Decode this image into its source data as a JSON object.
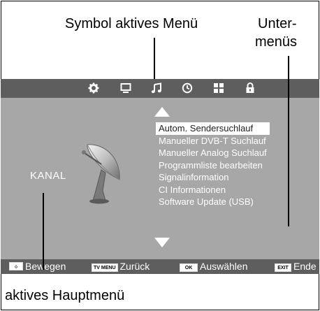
{
  "callouts": {
    "active_menu_symbol": "Symbol aktives Menü",
    "submenus_line1": "Unter-",
    "submenus_line2": "menüs",
    "active_main_menu": "aktives Hauptmenü"
  },
  "topbar": {
    "icons": [
      "gear-icon",
      "monitor-icon",
      "music-note-icon",
      "clock-icon",
      "grid-icon",
      "lock-icon"
    ],
    "active_icon": "music-note-icon"
  },
  "main_menu": {
    "label": "KANAL"
  },
  "submenu": {
    "items": [
      "Autom. Sendersuchlauf",
      "Manueller DVB-T Suchlauf",
      "Manueller Analog Suchlauf",
      "Programmliste bearbeiten",
      "Signalinformation",
      "CI Informationen",
      "Software Update (USB)"
    ],
    "selected_index": 0
  },
  "bottombar": {
    "nav_key": "✧",
    "nav_label": "Bewegen",
    "back_key": "TV MENU",
    "back_label": "Zurück",
    "ok_key": "OK",
    "ok_label": "Auswählen",
    "exit_key": "EXIT",
    "exit_label": "Ende"
  },
  "colors": {
    "screen_bg": "#a7a7a7",
    "bar_bg": "#5e5e5e",
    "text": "#ffffff"
  }
}
